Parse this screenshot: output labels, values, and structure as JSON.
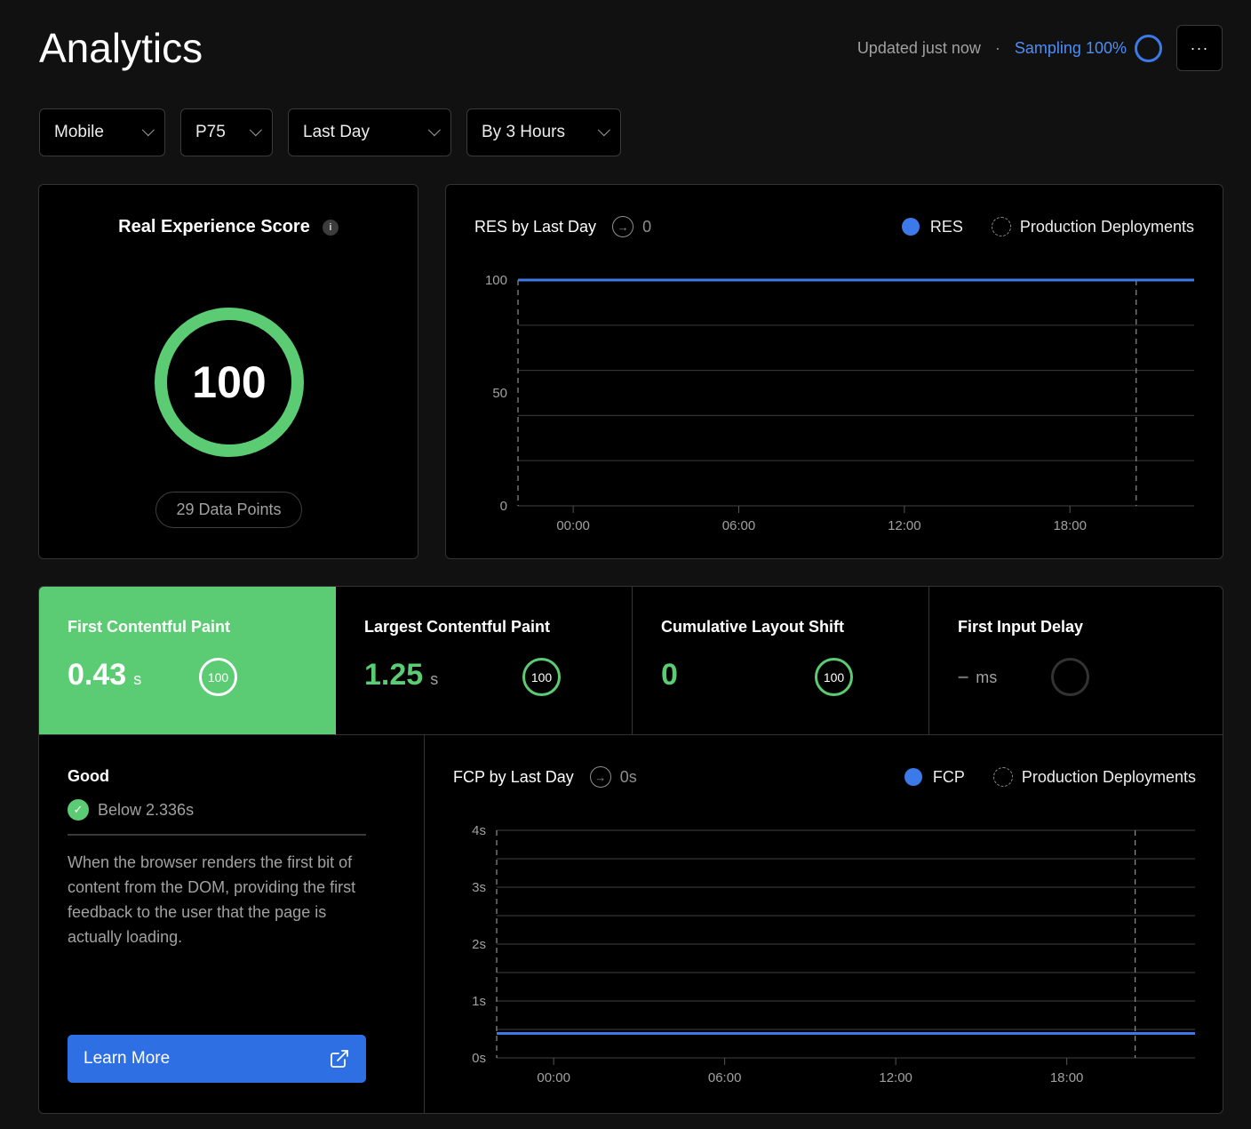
{
  "header": {
    "title": "Analytics",
    "updated": "Updated just now",
    "separator": "·",
    "sampling": "Sampling 100%",
    "more_label": "···"
  },
  "filters": [
    {
      "value": "Mobile"
    },
    {
      "value": "P75"
    },
    {
      "value": "Last Day"
    },
    {
      "value": "By 3 Hours"
    }
  ],
  "res_card": {
    "title": "Real Experience Score",
    "info": "i",
    "score": "100",
    "data_points": "29 Data Points",
    "score_color": "#5ccc74"
  },
  "res_chart": {
    "title": "RES by Last Day",
    "delta": "0",
    "legend_series": "RES",
    "legend_deploy": "Production Deployments"
  },
  "metrics": [
    {
      "name": "First Contentful Paint",
      "value": "0.43",
      "unit": "s",
      "score": "100",
      "active": true
    },
    {
      "name": "Largest Contentful Paint",
      "value": "1.25",
      "unit": "s",
      "score": "100",
      "active": false
    },
    {
      "name": "Cumulative Layout Shift",
      "value": "0",
      "unit": "",
      "score": "100",
      "active": false
    },
    {
      "name": "First Input Delay",
      "value": "–",
      "unit": "ms",
      "score": "",
      "active": false
    }
  ],
  "detail": {
    "rating": "Good",
    "threshold": "Below 2.336s",
    "description": "When the browser renders the first bit of content from the DOM, providing the first feedback to the user that the page is actually loading.",
    "learn_more": "Learn More"
  },
  "fcp_chart": {
    "title": "FCP by Last Day",
    "delta": "0s",
    "legend_series": "FCP",
    "legend_deploy": "Production Deployments"
  },
  "colors": {
    "accent_blue": "#3b7ae8",
    "good_green": "#5ccc74",
    "background": "#111111"
  },
  "chart_data": [
    {
      "type": "line",
      "title": "RES by Last Day",
      "xlabel": "",
      "ylabel": "",
      "x_ticks": [
        "00:00",
        "06:00",
        "12:00",
        "18:00"
      ],
      "y_ticks": [
        "0",
        "50",
        "100"
      ],
      "ylim": [
        0,
        100
      ],
      "xlim_hours": [
        -2,
        22.5
      ],
      "gridlines": [
        0,
        20,
        40,
        60,
        80,
        100
      ],
      "series": [
        {
          "name": "RES",
          "color": "#3b7ae8",
          "x_hours": [
            -2,
            22.5
          ],
          "values": [
            100,
            100
          ]
        }
      ],
      "deployments_hours": [
        -2,
        20.4
      ],
      "legend": "top-right"
    },
    {
      "type": "line",
      "title": "FCP by Last Day",
      "xlabel": "",
      "ylabel": "",
      "x_ticks": [
        "00:00",
        "06:00",
        "12:00",
        "18:00"
      ],
      "y_ticks": [
        "0s",
        "1s",
        "2s",
        "3s",
        "4s"
      ],
      "ylim": [
        0,
        4
      ],
      "xlim_hours": [
        -2,
        22.5
      ],
      "gridlines": [
        0,
        0.5,
        1,
        1.5,
        2,
        2.5,
        3,
        3.5,
        4
      ],
      "series": [
        {
          "name": "FCP",
          "color": "#3b7ae8",
          "x_hours": [
            -2,
            22.5
          ],
          "values": [
            0.43,
            0.43
          ]
        }
      ],
      "deployments_hours": [
        -2,
        20.4
      ],
      "legend": "top-right"
    }
  ]
}
